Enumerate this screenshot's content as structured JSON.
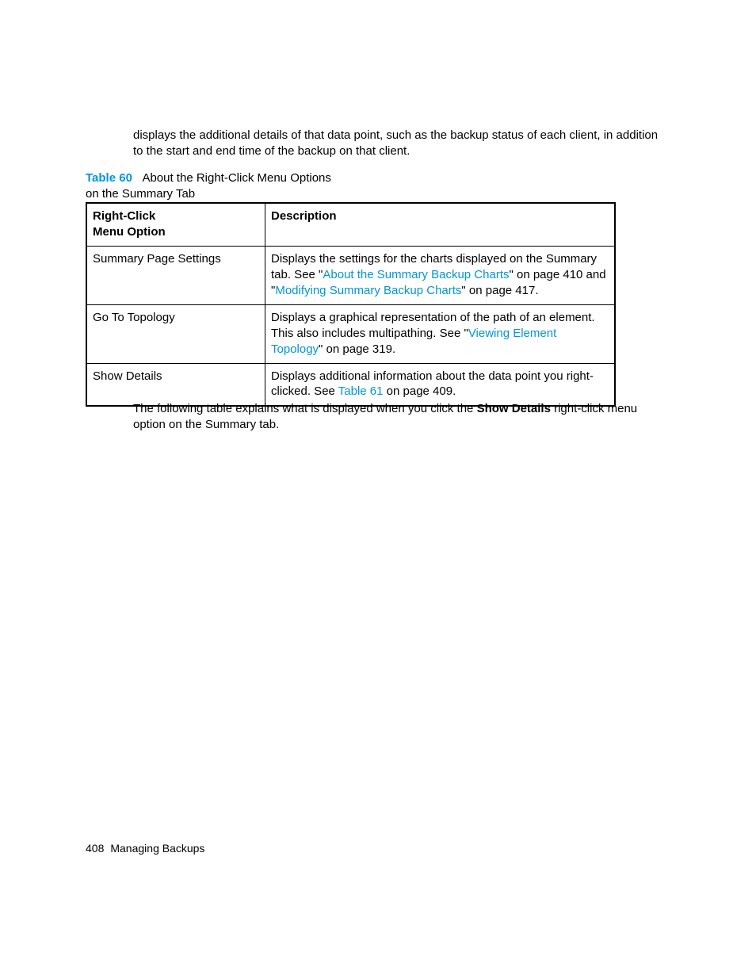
{
  "intro": "displays the additional details of that data point, such as the backup status of each client, in addition to the start and end time of the backup on that client.",
  "caption": {
    "label": "Table 60",
    "title_line1": "About the Right-Click Menu Options",
    "title_line2": "on the Summary Tab"
  },
  "table": {
    "headers": {
      "col1_line1": "Right-Click",
      "col1_line2": "Menu Option",
      "col2": "Description"
    },
    "rows": {
      "r1": {
        "option": "Summary Page Settings",
        "desc_a": "Displays the settings for the charts displayed on the Summary tab. See \"",
        "link1": "About the Summary Backup Charts",
        "desc_b": "\" on page 410 and \"",
        "link2": "Modifying Summary Backup Charts",
        "desc_c": "\" on page 417."
      },
      "r2": {
        "option": "Go To Topology",
        "desc_a": "Displays a graphical representation of the path of an element. This also includes multipathing. See \"",
        "link1": "Viewing Element Topology",
        "desc_b": "\" on page 319."
      },
      "r3": {
        "option": "Show Details",
        "desc_a": "Displays additional information about the data point you right-clicked. See ",
        "link1": "Table 61",
        "desc_b": " on page 409."
      }
    }
  },
  "following": {
    "part1": "The following table explains what is displayed when you click the ",
    "bold": "Show Details",
    "part2": " right-click menu option on the Summary tab."
  },
  "footer": {
    "page": "408",
    "section": "Managing Backups"
  }
}
